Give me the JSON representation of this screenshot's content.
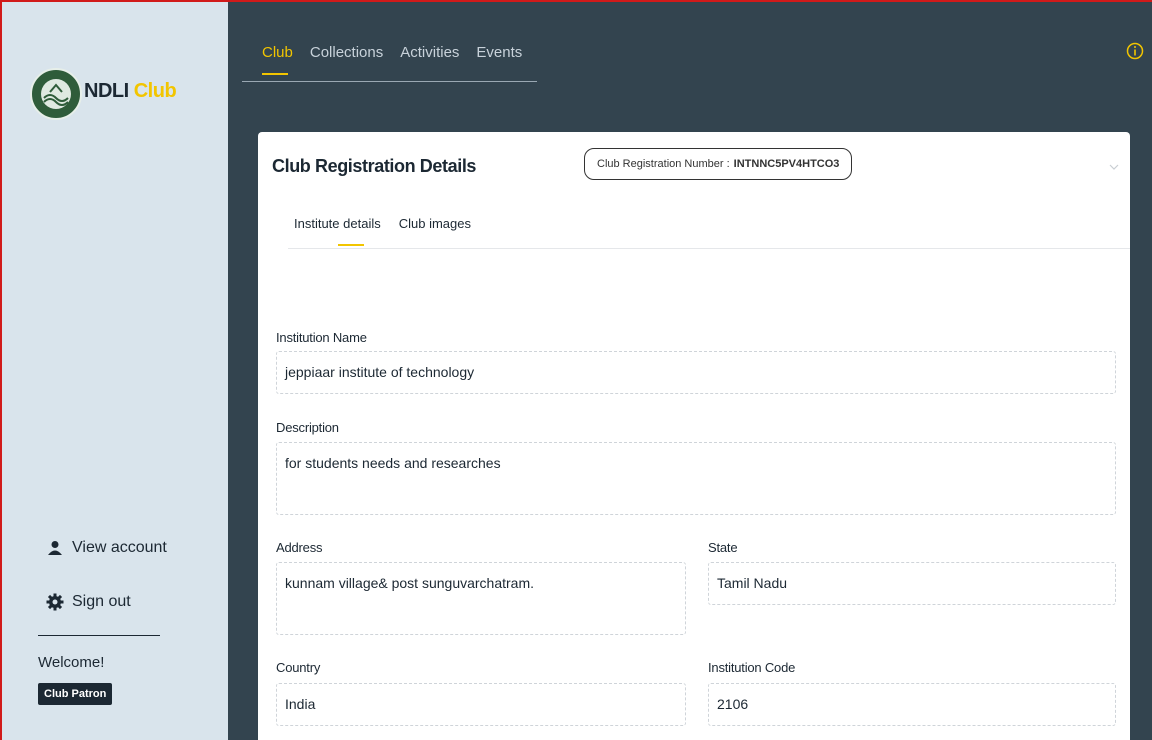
{
  "sidebar": {
    "brand_primary": "NDLI",
    "brand_accent": "Club",
    "view_account": "View account",
    "sign_out": "Sign out",
    "welcome": "Welcome!",
    "role": "Club Patron",
    "icons": {
      "user": "user-icon",
      "gear": "gear-icon",
      "logo": "ndli-logo-icon"
    }
  },
  "nav": {
    "tabs": [
      {
        "label": "Club",
        "active": true
      },
      {
        "label": "Collections",
        "active": false
      },
      {
        "label": "Activities",
        "active": false
      },
      {
        "label": "Events",
        "active": false
      }
    ]
  },
  "card": {
    "title": "Club Registration Details",
    "reg_label": "Club Registration Number :",
    "reg_value": "INTNNC5PV4HTCO3",
    "subtabs": [
      {
        "label": "Institute details",
        "active": true
      },
      {
        "label": "Club images",
        "active": false
      }
    ]
  },
  "form": {
    "institution_name": {
      "label": "Institution Name",
      "value": "jeppiaar institute of technology"
    },
    "description": {
      "label": "Description",
      "value": "for students needs and researches"
    },
    "address": {
      "label": "Address",
      "value": "kunnam village& post sunguvarchatram."
    },
    "state": {
      "label": "State",
      "value": "Tamil Nadu"
    },
    "country": {
      "label": "Country",
      "value": "India"
    },
    "institution_code": {
      "label": "Institution Code",
      "value": "2106"
    }
  },
  "colors": {
    "sidebar_bg": "#d9e4ec",
    "main_bg": "#33444f",
    "accent": "#f2c500",
    "text_dark": "#1c2833"
  }
}
